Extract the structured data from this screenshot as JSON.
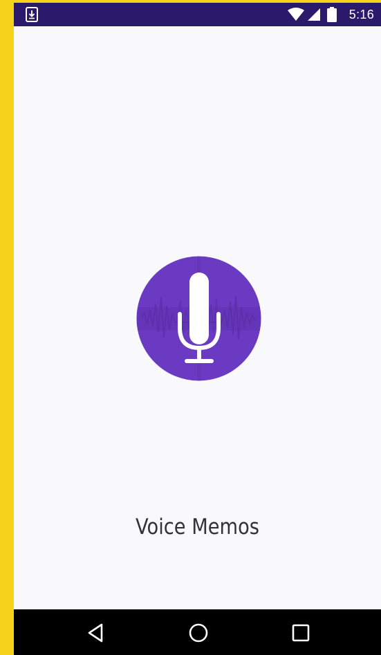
{
  "status_bar": {
    "time": "5:16",
    "left_icon": "download-notification-icon",
    "icons": [
      "wifi-icon",
      "cell-signal-icon",
      "battery-icon"
    ],
    "background": "#2b1a6c"
  },
  "splash": {
    "app_icon": "microphone-icon",
    "title": "Voice Memos",
    "icon_color": "#6a3bc2",
    "background": "#f9f9fb"
  },
  "nav_bar": {
    "buttons": [
      "back-icon",
      "home-icon",
      "recents-icon"
    ]
  },
  "frame_color": "#f6d21a"
}
